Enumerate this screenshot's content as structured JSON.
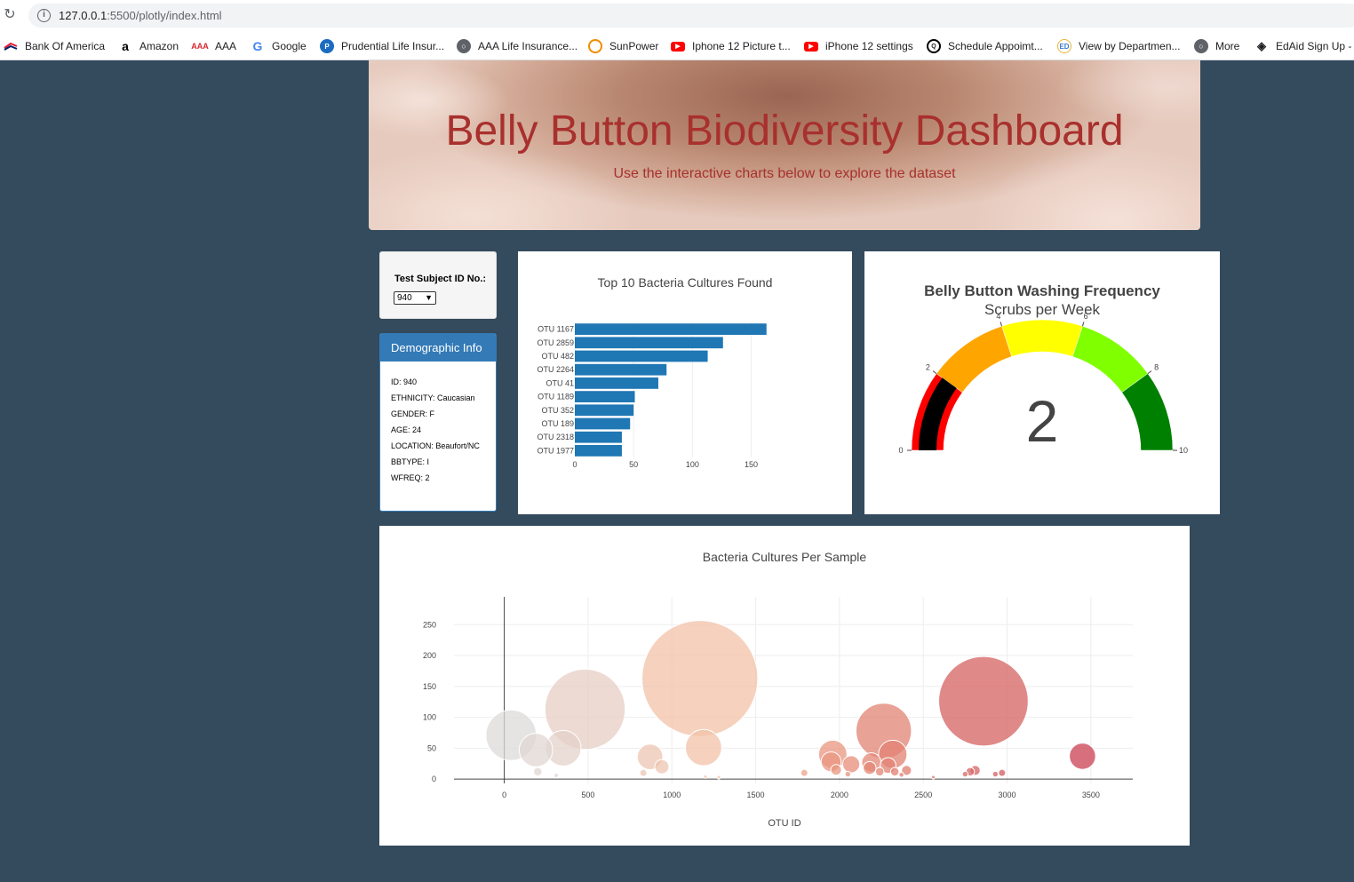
{
  "browser": {
    "url_host": "127.0.0.1",
    "url_rest": ":5500/plotly/index.html",
    "bookmarks": [
      {
        "label": "Bank Of America",
        "icon": "bank-of-america-icon"
      },
      {
        "label": "Amazon",
        "icon": "amazon-icon"
      },
      {
        "label": "AAA",
        "icon": "aaa-icon"
      },
      {
        "label": "Google",
        "icon": "google-icon"
      },
      {
        "label": "Prudential Life Insur...",
        "icon": "prudential-icon"
      },
      {
        "label": "AAA Life Insurance...",
        "icon": "globe-icon"
      },
      {
        "label": "SunPower",
        "icon": "sunpower-icon"
      },
      {
        "label": "Iphone 12 Picture t...",
        "icon": "youtube-icon"
      },
      {
        "label": "iPhone 12 settings",
        "icon": "youtube-icon"
      },
      {
        "label": "Schedule Appoimt...",
        "icon": "schedule-icon"
      },
      {
        "label": "View by Departmen...",
        "icon": "department-icon"
      },
      {
        "label": "More",
        "icon": "globe-icon"
      },
      {
        "label": "EdAid Sign Up -",
        "icon": "edaid-icon"
      }
    ]
  },
  "banner": {
    "title": "Belly Button Biodiversity Dashboard",
    "subtitle": "Use the interactive charts below to explore the dataset"
  },
  "selector": {
    "label": "Test Subject ID No.:",
    "value": "940"
  },
  "demographic": {
    "title": "Demographic Info",
    "lines": [
      "ID: 940",
      "ETHNICITY: Caucasian",
      "GENDER: F",
      "AGE: 24",
      "LOCATION: Beaufort/NC",
      "BBTYPE: I",
      "WFREQ: 2"
    ]
  },
  "colors": {
    "bar": "#1f77b4",
    "gauge_steps": [
      "#ff0000",
      "#ffa500",
      "#ffff00",
      "#7fff00",
      "#008000"
    ],
    "gauge_bar": "#000000"
  },
  "chart_data": [
    {
      "type": "bar",
      "orientation": "horizontal",
      "title": "Top 10 Bacteria Cultures Found",
      "categories": [
        "OTU 1167",
        "OTU 2859",
        "OTU 482",
        "OTU 2264",
        "OTU 41",
        "OTU 1189",
        "OTU 352",
        "OTU 189",
        "OTU 2318",
        "OTU 1977"
      ],
      "values": [
        163,
        126,
        113,
        78,
        71,
        51,
        50,
        47,
        40,
        40
      ],
      "xlim": [
        0,
        170
      ],
      "xticks": [
        0,
        50,
        100,
        150
      ]
    },
    {
      "type": "gauge",
      "title": "Belly Button Washing Frequency",
      "subtitle": "Scrubs per Week",
      "value": 2,
      "range": [
        0,
        10
      ],
      "ticks": [
        0,
        2,
        4,
        6,
        8,
        10
      ],
      "steps": [
        [
          0,
          2
        ],
        [
          2,
          4
        ],
        [
          4,
          6
        ],
        [
          6,
          8
        ],
        [
          8,
          10
        ]
      ]
    },
    {
      "type": "scatter",
      "title": "Bacteria Cultures Per Sample",
      "xlabel": "OTU ID",
      "ylabel": "",
      "xlim": [
        -300,
        3750
      ],
      "ylim": [
        -7,
        295
      ],
      "xticks": [
        0,
        500,
        1000,
        1500,
        2000,
        2500,
        3000,
        3500
      ],
      "yticks": [
        0,
        50,
        100,
        150,
        200,
        250
      ],
      "grid": true,
      "points": [
        {
          "x": 41,
          "y": 71
        },
        {
          "x": 189,
          "y": 47
        },
        {
          "x": 352,
          "y": 50
        },
        {
          "x": 482,
          "y": 113
        },
        {
          "x": 200,
          "y": 12
        },
        {
          "x": 310,
          "y": 6
        },
        {
          "x": 870,
          "y": 36
        },
        {
          "x": 940,
          "y": 20
        },
        {
          "x": 830,
          "y": 10
        },
        {
          "x": 1167,
          "y": 163
        },
        {
          "x": 1189,
          "y": 51
        },
        {
          "x": 1200,
          "y": 4
        },
        {
          "x": 1280,
          "y": 3
        },
        {
          "x": 1790,
          "y": 10
        },
        {
          "x": 1960,
          "y": 40
        },
        {
          "x": 1950,
          "y": 28
        },
        {
          "x": 1980,
          "y": 15
        },
        {
          "x": 2070,
          "y": 24
        },
        {
          "x": 2050,
          "y": 8
        },
        {
          "x": 2190,
          "y": 27
        },
        {
          "x": 2180,
          "y": 18
        },
        {
          "x": 2264,
          "y": 78
        },
        {
          "x": 2318,
          "y": 40
        },
        {
          "x": 2290,
          "y": 22
        },
        {
          "x": 2240,
          "y": 12
        },
        {
          "x": 2330,
          "y": 12
        },
        {
          "x": 2400,
          "y": 14
        },
        {
          "x": 2370,
          "y": 7
        },
        {
          "x": 2560,
          "y": 3
        },
        {
          "x": 2780,
          "y": 12
        },
        {
          "x": 2750,
          "y": 8
        },
        {
          "x": 2810,
          "y": 14
        },
        {
          "x": 2859,
          "y": 126
        },
        {
          "x": 2930,
          "y": 8
        },
        {
          "x": 2970,
          "y": 10
        },
        {
          "x": 3450,
          "y": 37
        }
      ]
    }
  ]
}
